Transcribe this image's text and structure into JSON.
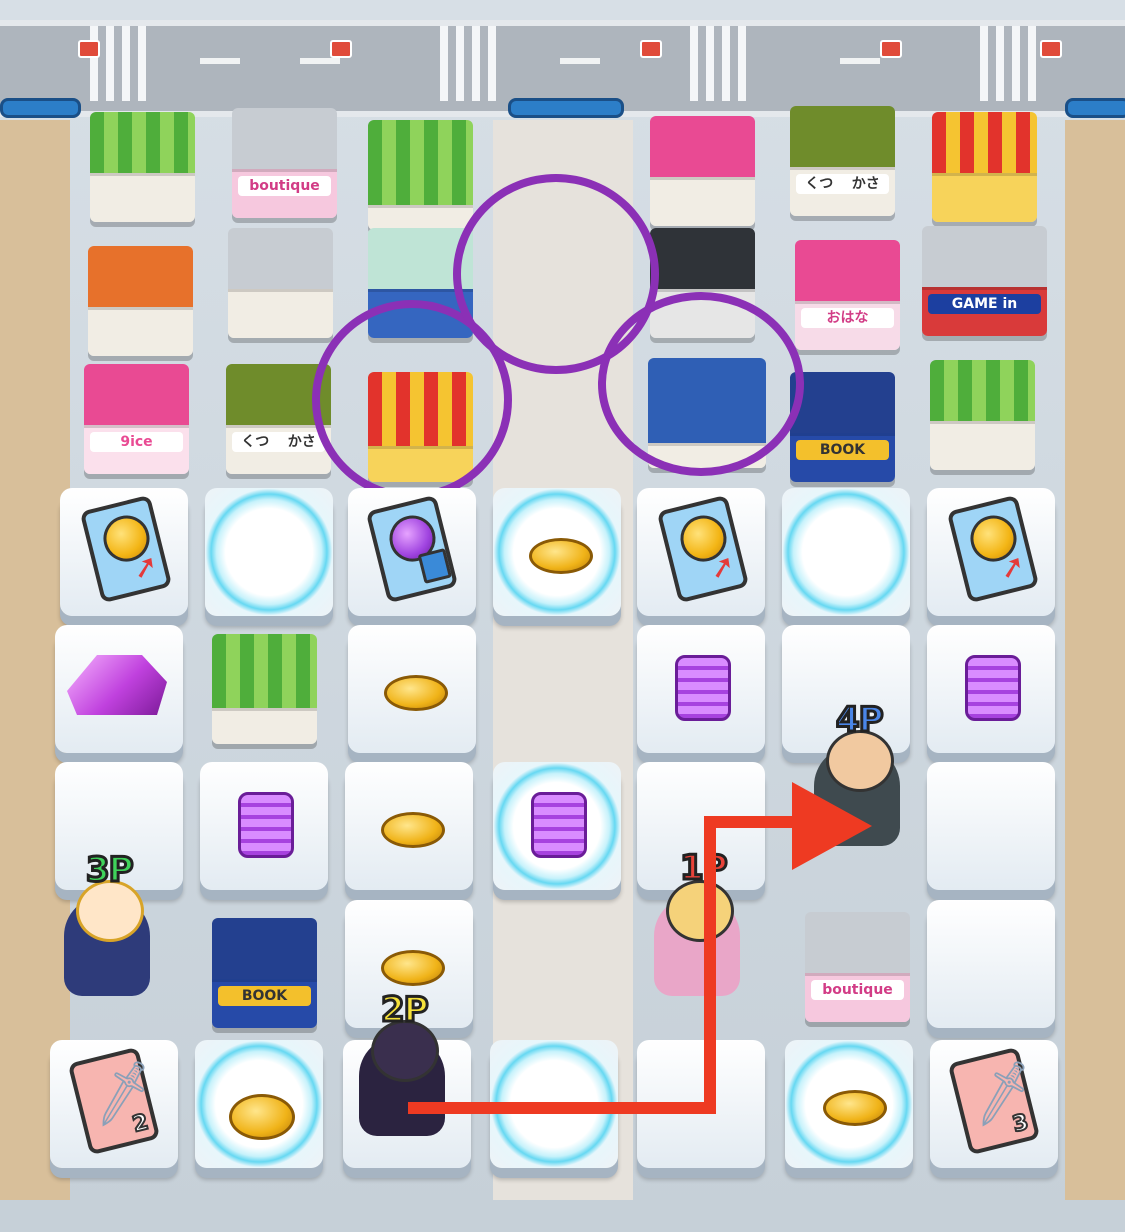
{
  "signs": {
    "boutique": "boutique",
    "ice": "9ice",
    "book": "BOOK",
    "gamein": "GAME in",
    "ohana": "おはな",
    "kutsu_left": "くつ",
    "kasa_left": "かさ",
    "kutsu_right": "くつ",
    "kasa_right": "かさ"
  },
  "players": [
    {
      "label": "1P",
      "color": "#e8433a"
    },
    {
      "label": "2P",
      "color": "#f6e23a"
    },
    {
      "label": "3P",
      "color": "#3fd35a"
    },
    {
      "label": "4P",
      "color": "#4a86e8"
    }
  ],
  "cards": {
    "sword_left_count": "2",
    "sword_right_count": "3"
  },
  "colors": {
    "highlight_ring": "#8b30b6",
    "route_arrow": "#ee3a22"
  }
}
